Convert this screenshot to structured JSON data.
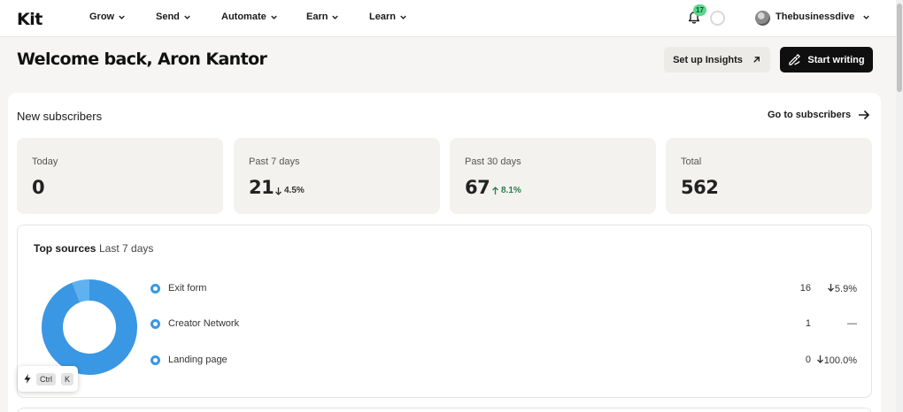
{
  "nav": {
    "logo": "Kit",
    "items": [
      {
        "label": "Grow"
      },
      {
        "label": "Send"
      },
      {
        "label": "Automate"
      },
      {
        "label": "Earn"
      },
      {
        "label": "Learn"
      }
    ],
    "notification_count": "17",
    "account_name": "Thebusinessdive"
  },
  "header": {
    "welcome": "Welcome back, Aron Kantor",
    "insights_button": "Set up Insights",
    "write_button": "Start writing"
  },
  "subscribers": {
    "title": "New subscribers",
    "goto_link": "Go to subscribers",
    "stats": [
      {
        "label": "Today",
        "value": "0",
        "change": ""
      },
      {
        "label": "Past 7 days",
        "value": "21",
        "change": "4.5%",
        "direction": "down"
      },
      {
        "label": "Past 30 days",
        "value": "67",
        "change": "8.1%",
        "direction": "up"
      },
      {
        "label": "Total",
        "value": "562",
        "change": ""
      }
    ]
  },
  "sources": {
    "title": "Top sources",
    "period": "Last 7 days",
    "rows": [
      {
        "name": "Exit form",
        "count": "16",
        "change": "5.9%",
        "direction": "down"
      },
      {
        "name": "Creator Network",
        "count": "1",
        "change": "—",
        "direction": "none"
      },
      {
        "name": "Landing page",
        "count": "0",
        "change": "100.0%",
        "direction": "down"
      }
    ],
    "donut_values": [
      16,
      1,
      0
    ],
    "donut_colors": [
      "#3a97e3",
      "#5fb1f0",
      "#8cc8f5"
    ]
  },
  "shortcut": {
    "key1": "Ctrl",
    "key2": "K"
  },
  "colors": {
    "accent_green": "#5bd68a",
    "up_green": "#2e7d4f",
    "donut_blue": "#3a97e3",
    "primary_dark": "#0f0f0f"
  }
}
